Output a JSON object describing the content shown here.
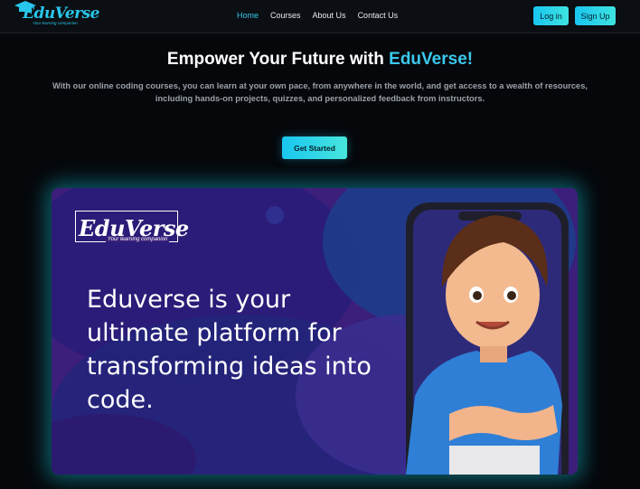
{
  "nav": {
    "logo_text": "EduVerse",
    "logo_tagline": "Your learning companion",
    "links": [
      "Home",
      "Courses",
      "About Us",
      "Contact Us"
    ],
    "active_link": "Home",
    "login_label": "Log in",
    "signup_label": "Sign Up"
  },
  "hero": {
    "title_prefix": "Empower Your Future with ",
    "title_highlight": "EduVerse!",
    "description": "With our online coding courses, you can learn at your own pace, from anywhere in the world, and get access to a wealth of resources, including hands-on projects, quizzes, and personalized feedback from instructors.",
    "cta_label": "Get Started"
  },
  "banner": {
    "logo_text": "EduVerse",
    "logo_tagline": "Your learning companion",
    "headline": "Eduverse is your ultimate platform for transforming ideas into code."
  },
  "colors": {
    "accent": "#35c8ea",
    "background": "#05070b",
    "banner_purple": "#3a1f79"
  }
}
